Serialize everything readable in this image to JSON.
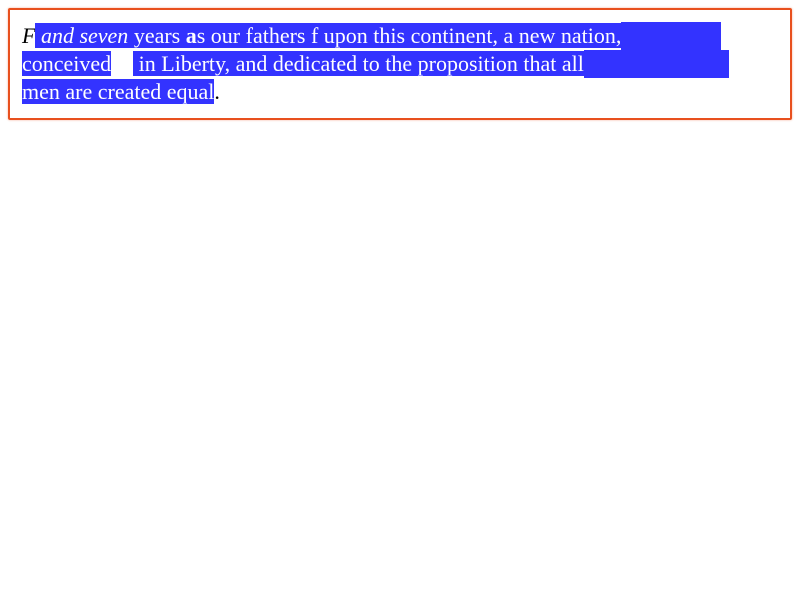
{
  "editor": {
    "line1": {
      "t0": "F",
      "t1": " and seven",
      "t2": " years ",
      "t3": "a",
      "t4": "s",
      "t5": " our fathers f upon this continent, a new nation,"
    },
    "line2": {
      "t0": "conceived",
      "t1": " in Liberty, and dedicated to the proposition that all"
    },
    "line3": {
      "t0": "men are created equal",
      "t1": "."
    },
    "colors": {
      "selection": "#3333ff",
      "selection_text": "#ffffff",
      "focus_border": "#e8501e"
    }
  }
}
